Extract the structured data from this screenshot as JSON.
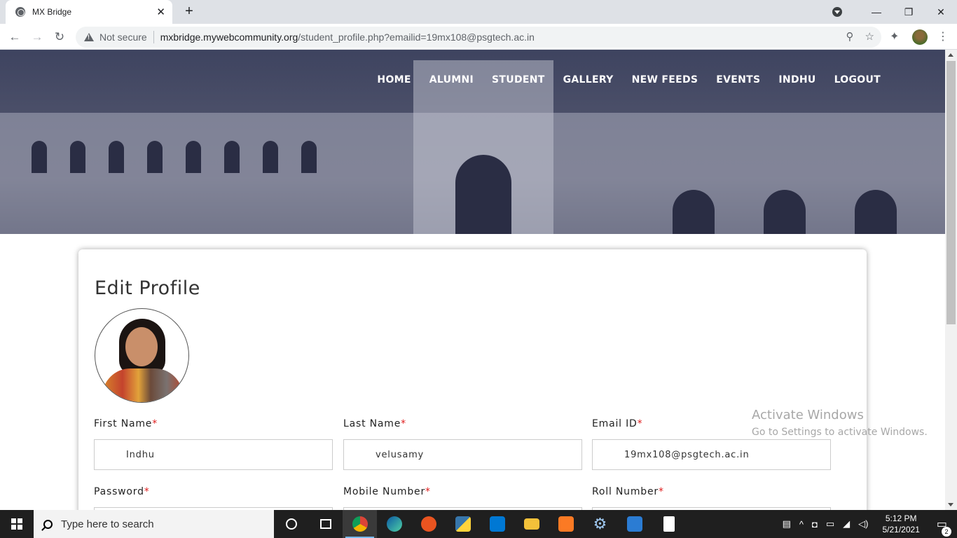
{
  "browser": {
    "tab_title": "MX Bridge",
    "tab_close": "✕",
    "new_tab": "+",
    "security_label": "Not secure",
    "url_host": "mxbridge.mywebcommunity.org",
    "url_path": "/student_profile.php?emailid=19mx108@psgtech.ac.in",
    "minimize": "—",
    "restore": "❐",
    "close": "✕"
  },
  "nav": {
    "items": [
      "HOME",
      "ALUMNI",
      "STUDENT",
      "GALLERY",
      "NEW FEEDS",
      "EVENTS",
      "INDHU",
      "LOGOUT"
    ]
  },
  "profile": {
    "title": "Edit Profile",
    "required_mark": "*",
    "fields": [
      {
        "label": "First Name",
        "value": "Indhu"
      },
      {
        "label": "Last Name",
        "value": "velusamy"
      },
      {
        "label": "Email ID",
        "value": "19mx108@psgtech.ac.in"
      },
      {
        "label": "Password",
        "value": ""
      },
      {
        "label": "Mobile Number",
        "value": ""
      },
      {
        "label": "Roll Number",
        "value": ""
      }
    ]
  },
  "watermark": {
    "line1": "Activate Windows",
    "line2": "Go to Settings to activate Windows."
  },
  "taskbar": {
    "search_placeholder": "Type here to search",
    "time": "5:12 PM",
    "date": "5/21/2021",
    "notification_count": "2"
  },
  "colors": {
    "required": "#e02020",
    "taskbar": "#1f1f1f",
    "hero_overlay": "#191e37"
  }
}
